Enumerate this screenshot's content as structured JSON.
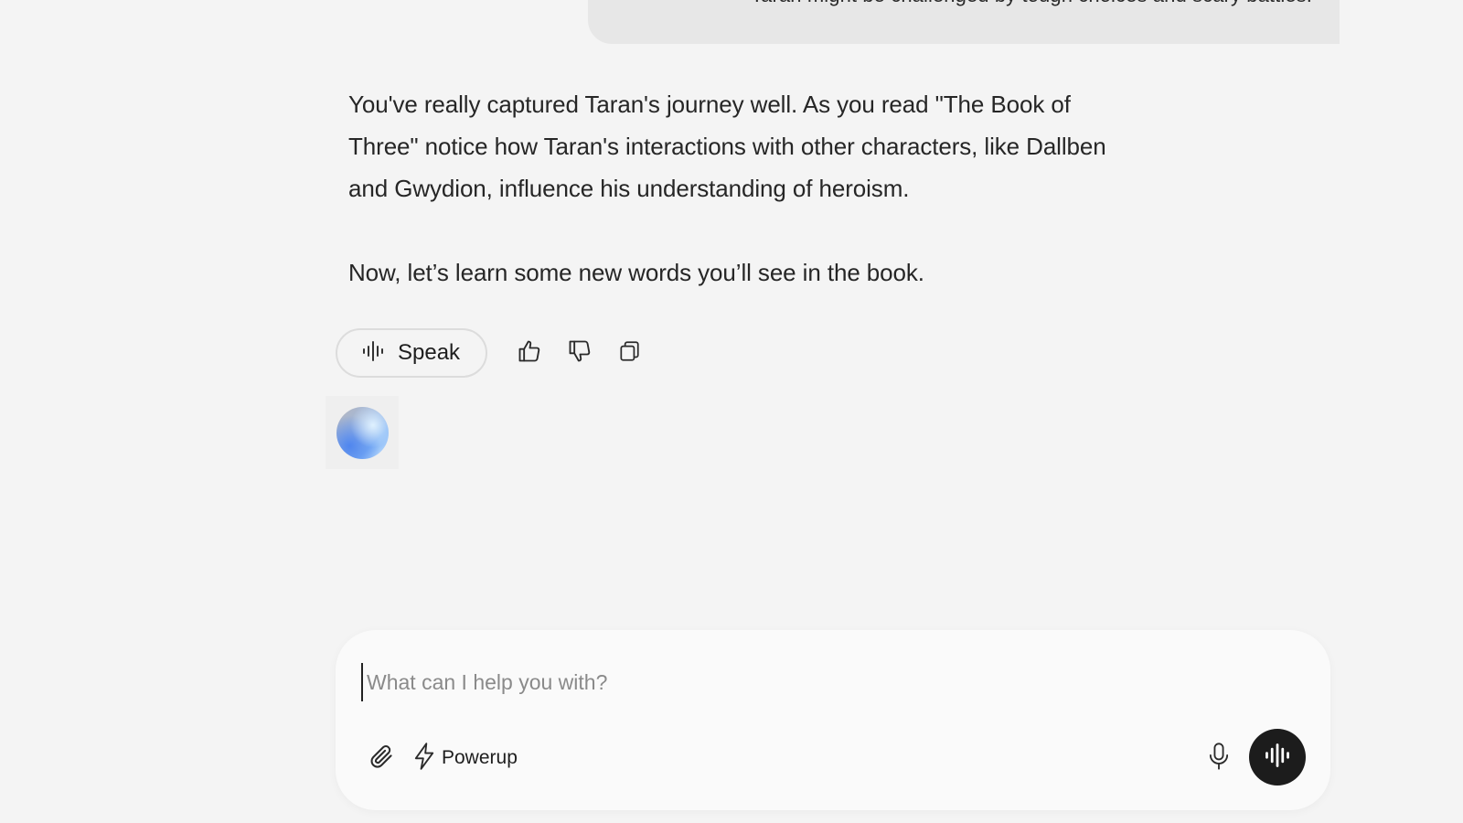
{
  "conversation": {
    "user_message_tail": "Taran might be challenged by tough choices and scary battles.",
    "assistant_paragraphs": [
      "You've really captured Taran's journey well. As you read \"The Book of Three\" notice how Taran's interactions with other characters, like Dallben and Gwydion, influence his understanding of heroism.",
      "Now, let’s learn some new words you’ll see in the book."
    ]
  },
  "actions": {
    "speak_label": "Speak",
    "speak_icon": "audio-waveform-icon",
    "like_icon": "thumbs-up-icon",
    "dislike_icon": "thumbs-down-icon",
    "copy_icon": "copy-icon"
  },
  "composer": {
    "placeholder": "What can I help you with?",
    "value": "",
    "attach_icon": "paperclip-icon",
    "powerup_label": "Powerup",
    "powerup_icon": "lightning-bolt-icon",
    "mic_icon": "microphone-icon",
    "voice_icon": "voice-mode-waveform-icon"
  },
  "colors": {
    "background": "#f4f4f4",
    "user_bubble": "#e7e7e7",
    "composer": "#fafafa",
    "voice_button": "#1c1c1c",
    "avatar_accent": "#4f86ef"
  }
}
